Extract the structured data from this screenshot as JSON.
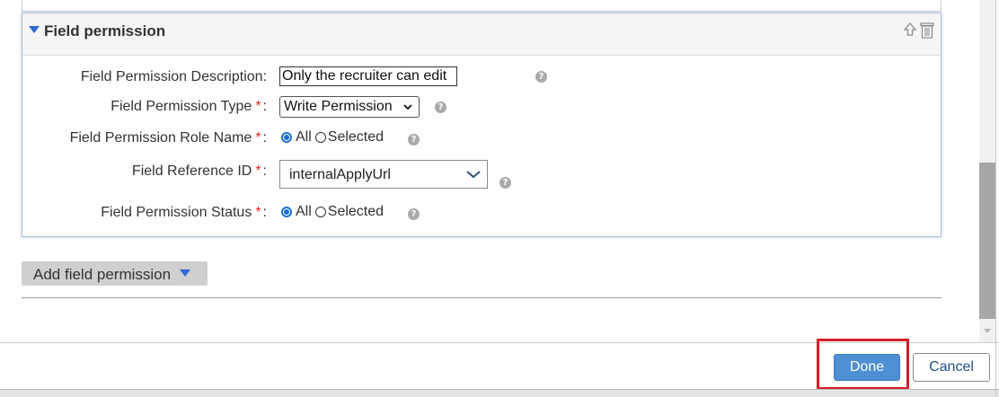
{
  "panel": {
    "title": "Field permission"
  },
  "form": {
    "description_label": "Field Permission Description:",
    "description_value": "Only the recruiter can edit",
    "type_label": "Field Permission Type",
    "type_value": "Write Permission",
    "role_label": "Field Permission Role Name",
    "role_options": [
      "All",
      "Selected"
    ],
    "role_selected": "All",
    "ref_label": "Field Reference ID",
    "ref_value": "internalApplyUrl",
    "status_label": "Field Permission Status",
    "status_options": [
      "All",
      "Selected"
    ],
    "status_selected": "All",
    "required_mark": "*",
    "colon": ":",
    "help_glyph": "?"
  },
  "add_field_permission_label": "Add field permission",
  "footer": {
    "done_label": "Done",
    "cancel_label": "Cancel"
  },
  "colors": {
    "accent_blue": "#4f8fd4",
    "required_red": "#e0262a",
    "highlight_red": "#d51f26"
  },
  "icons": [
    "collapse-triangle-icon",
    "move-up-icon",
    "delete-icon",
    "help-icon",
    "chevron-down-icon",
    "dropdown-triangle-icon"
  ]
}
